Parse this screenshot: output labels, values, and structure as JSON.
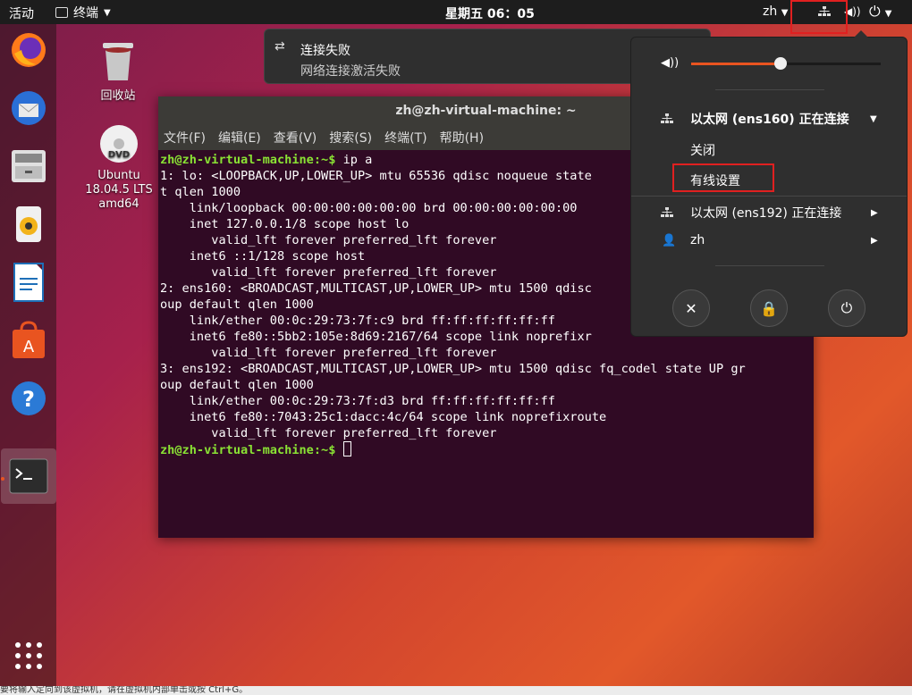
{
  "topbar": {
    "activities": "活动",
    "app_name": "终端",
    "clock": "星期五 06：05",
    "lang": "zh"
  },
  "desktop": {
    "trash_label": "回收站",
    "dvd_label_1": "Ubuntu",
    "dvd_label_2": "18.04.5 LTS",
    "dvd_label_3": "amd64"
  },
  "notification": {
    "title": "连接失败",
    "body": "网络连接激活失败"
  },
  "terminal": {
    "title": "zh@zh-virtual-machine: ~",
    "menu": [
      "文件(F)",
      "编辑(E)",
      "查看(V)",
      "搜索(S)",
      "终端(T)",
      "帮助(H)"
    ],
    "prompt": "zh@zh-virtual-machine:~$",
    "command": " ip a",
    "lines": [
      "1: lo: <LOOPBACK,UP,LOWER_UP> mtu 65536 qdisc noqueue state",
      "t qlen 1000",
      "    link/loopback 00:00:00:00:00:00 brd 00:00:00:00:00:00",
      "    inet 127.0.0.1/8 scope host lo",
      "       valid_lft forever preferred_lft forever",
      "    inet6 ::1/128 scope host",
      "       valid_lft forever preferred_lft forever",
      "2: ens160: <BROADCAST,MULTICAST,UP,LOWER_UP> mtu 1500 qdisc",
      "oup default qlen 1000",
      "    link/ether 00:0c:29:73:7f:c9 brd ff:ff:ff:ff:ff:ff",
      "    inet6 fe80::5bb2:105e:8d69:2167/64 scope link noprefixr",
      "       valid_lft forever preferred_lft forever",
      "3: ens192: <BROADCAST,MULTICAST,UP,LOWER_UP> mtu 1500 qdisc fq_codel state UP gr",
      "oup default qlen 1000",
      "    link/ether 00:0c:29:73:7f:d3 brd ff:ff:ff:ff:ff:ff",
      "    inet6 fe80::7043:25c1:dacc:4c/64 scope link noprefixroute",
      "       valid_lft forever preferred_lft forever"
    ],
    "final_prompt": "zh@zh-virtual-machine:~$"
  },
  "sysmenu": {
    "volume_level": 0.47,
    "eth1_label": "以太网 (ens160) 正在连接",
    "eth1_off": "关闭",
    "eth1_settings": "有线设置",
    "eth2_label": "以太网 (ens192) 正在连接",
    "user": "zh"
  },
  "statusbar": {
    "text": "要将输入定向到该虚拟机，请在虚拟机内部单击或按 Ctrl+G。"
  },
  "colors": {
    "accent": "#e95420",
    "terminal_bg": "#300a24",
    "prompt_green": "#8ae234",
    "highlight_red": "#e02020"
  }
}
